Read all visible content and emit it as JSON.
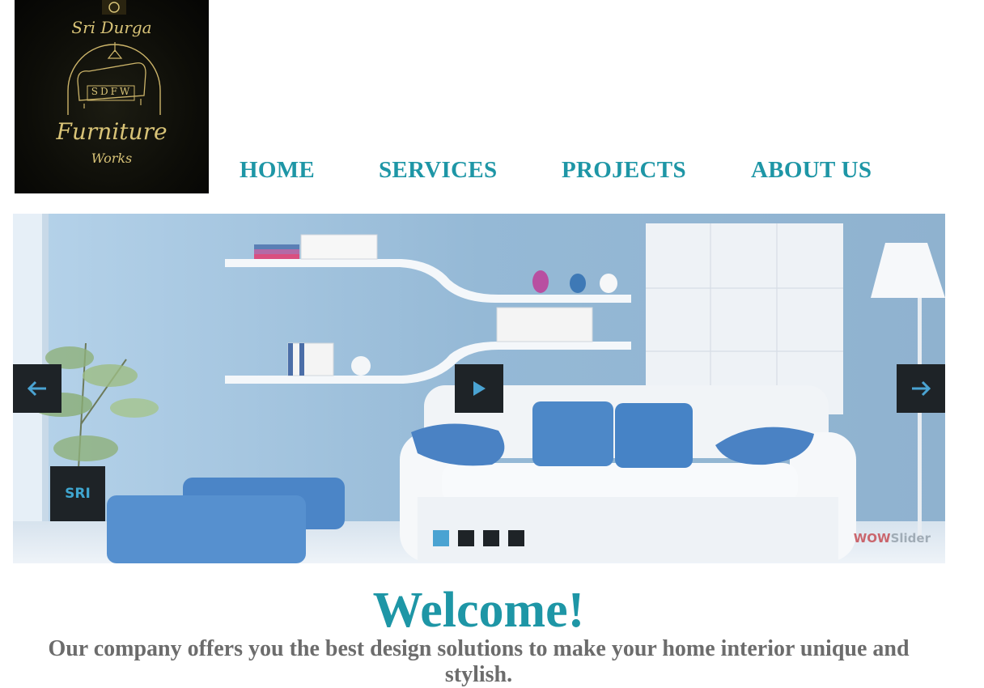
{
  "logo": {
    "line1": "Sri Durga",
    "monogram": "SDFW",
    "line2": "Furniture",
    "line3": "Works"
  },
  "nav": {
    "items": [
      {
        "label": "HOME"
      },
      {
        "label": "SERVICES"
      },
      {
        "label": "PROJECTS"
      },
      {
        "label": "ABOUT US"
      }
    ]
  },
  "slider": {
    "caption": "SRI",
    "watermark_a": "WOW",
    "watermark_b": "Slider",
    "bullet_count": 4,
    "active_bullet": 1,
    "icons": [
      "arrow-left-icon",
      "play-icon",
      "arrow-right-icon"
    ]
  },
  "welcome": {
    "title": "Welcome!",
    "text": "Our company offers you the best design solutions to make your home interior unique and stylish."
  },
  "colors": {
    "accent": "#1e96a6",
    "text_gray": "#6c6c6c",
    "control_bg": "#1e2327",
    "bullet_active": "#4aa3d2"
  }
}
